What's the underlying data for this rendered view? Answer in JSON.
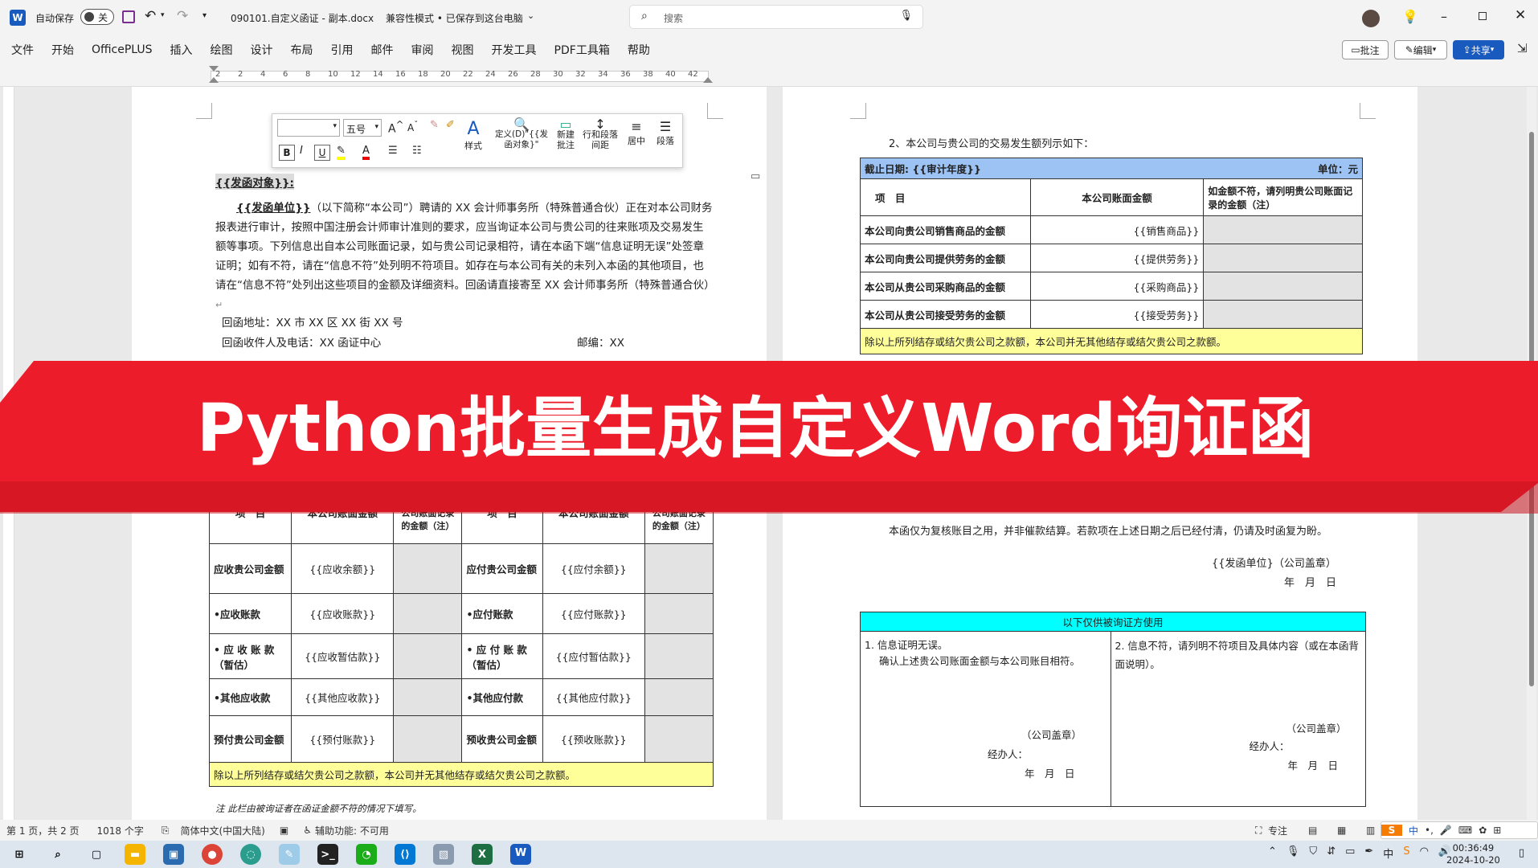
{
  "titlebar": {
    "autosave_label": "自动保存",
    "autosave_state": "关",
    "doc_title": "090101.自定义函证 - 副本.docx",
    "doc_status": "兼容性模式 • 已保存到这台电脑",
    "search_placeholder": "搜索"
  },
  "menu": [
    "文件",
    "开始",
    "OfficePLUS",
    "插入",
    "绘图",
    "设计",
    "布局",
    "引用",
    "邮件",
    "审阅",
    "视图",
    "开发工具",
    "PDF工具箱",
    "帮助"
  ],
  "right_buttons": {
    "comment": "批注",
    "edit": "编辑",
    "share": "共享"
  },
  "ruler_ticks": [
    "2",
    "2",
    "4",
    "6",
    "8",
    "10",
    "12",
    "14",
    "16",
    "18",
    "20",
    "22",
    "24",
    "26",
    "28",
    "30",
    "32",
    "34",
    "36",
    "38",
    "40",
    "42"
  ],
  "mini_toolbar": {
    "font_size": "五号",
    "styles": "样式",
    "define": "定义(D)\"{{发函对象}\"",
    "new_comment": "新建批注",
    "line_spacing": "行和段落间距",
    "center": "居中",
    "paragraph": "段落"
  },
  "left_page": {
    "salutation": "{{发函对象}}:",
    "body_unit": "{{发函单位}}",
    "body_text": "（以下简称“本公司”）聘请的 XX 会计师事务所（特殊普通合伙）正在对本公司财务报表进行审计，按照中国注册会计师审计准则的要求，应当询证本公司与贵公司的往来账项及交易发生额等事项。下列信息出自本公司账面记录，如与贵公司记录相符，请在本函下端“信息证明无误”处签章证明；如有不符，请在“信息不符”处列明不符项目。如存在与本公司有关的未列入本函的其他项目，也请在“信息不符”处列出这些项目的金额及详细资料。回函请直接寄至 XX 会计师事务所（特殊普通合伙）",
    "address": "回函地址：XX 市 XX 区 XX 街 XX 号",
    "contact": "回函收件人及电话：XX 函证中心",
    "postcode": "邮编：XX",
    "table_header": [
      "项　目",
      "本公司账面金额",
      "符，请列明贵公司账面记录的金额（注）",
      "项　目",
      "本公司账面金额",
      "符，请列明贵公司账面记录的金额（注）"
    ],
    "rows": [
      [
        "应收贵公司金额",
        "{{应收余额}}",
        "",
        "应付贵公司金额",
        "{{应付余额}}",
        ""
      ],
      [
        "•应收账款",
        "{{应收账款}}",
        "",
        "•应付账款",
        "{{应付账款}}",
        ""
      ],
      [
        "• 应 收 账 款（暂估）",
        "{{应收暂估款}}",
        "",
        "• 应 付 账 款（暂估）",
        "{{应付暂估款}}",
        ""
      ],
      [
        "•其他应收款",
        "{{其他应收款}}",
        "",
        "•其他应付款",
        "{{其他应付款}}",
        ""
      ],
      [
        "预付贵公司金额",
        "{{预付账款}}",
        "",
        "预收贵公司金额",
        "{{预收账款}}",
        ""
      ]
    ],
    "footer_note": "除以上所列结存或结欠贵公司之款额，本公司并无其他结存或结欠贵公司之款额。",
    "footnote": "注 此栏由被询证者在函证金额不符的情况下填写。"
  },
  "right_page": {
    "item2": "2、本公司与贵公司的交易发生额列示如下：",
    "table_head_left": "截止日期: {{审计年度}}",
    "table_head_right": "单位：元",
    "col_headers": [
      "项　目",
      "本公司账面金额",
      "如金额不符，请列明贵公司账面记录的金额（注）"
    ],
    "rows": [
      [
        "本公司向贵公司销售商品的金额",
        "{{销售商品}}"
      ],
      [
        "本公司向贵公司提供劳务的金额",
        "{{提供劳务}}"
      ],
      [
        "本公司从贵公司采购商品的金额",
        "{{采购商品}}"
      ],
      [
        "本公司从贵公司接受劳务的金额",
        "{{接受劳务}}"
      ]
    ],
    "footer_note": "除以上所列结存或结欠贵公司之款额，本公司并无其他结存或结欠贵公司之款额。",
    "remark": "本函仅为复核账目之用，并非催款结算。若款项在上述日期之后已经付清，仍请及时函复为盼。",
    "sign_unit": "{{发函单位}（公司盖章）",
    "date": "年　月　日",
    "confirm_title": "以下仅供被询证方使用",
    "confirm_left_1": "1. 信息证明无误。",
    "confirm_left_2": "确认上述贵公司账面金额与本公司账目相符。",
    "confirm_right": "2. 信息不符，请列明不符项目及具体内容（或在本函背面说明）。",
    "seal": "（公司盖章）",
    "handler": "经办人：",
    "ymd": "年　月　日"
  },
  "banner_text": "Python批量生成自定义Word询证函",
  "status": {
    "page": "第 1 页，共 2 页",
    "words": "1018 个字",
    "lang": "简体中文(中国大陆)",
    "accessibility": "辅助功能: 不可用",
    "focus": "专注"
  },
  "clock": {
    "time": "00:36:49",
    "date": "2024-10-20"
  },
  "colors": {
    "word_blue": "#185abd",
    "banner_red": "#ec1c2b",
    "header_blue": "#9dc3f5",
    "yellow": "#ffff99",
    "cyan": "#00ffff"
  }
}
